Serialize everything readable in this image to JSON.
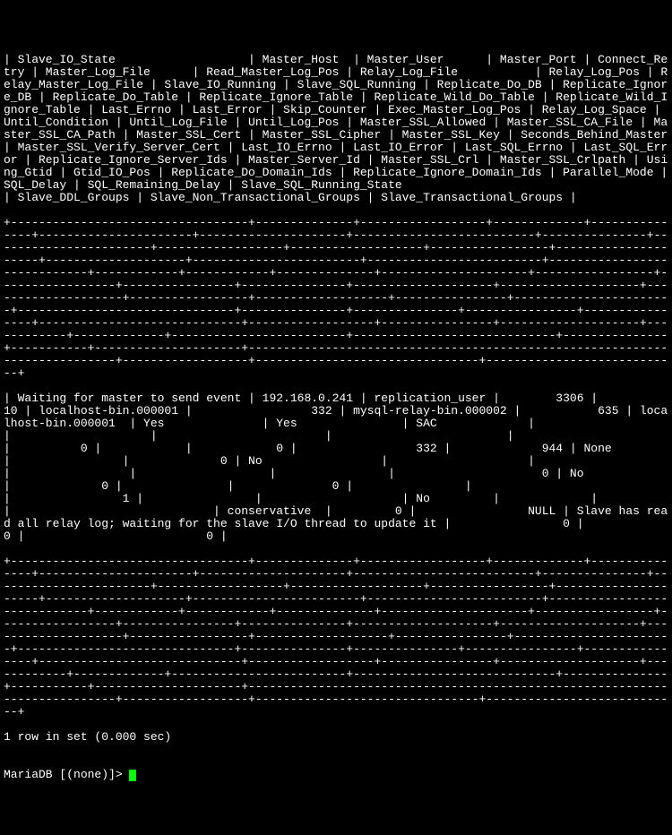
{
  "header_line": "| Slave_IO_State                   | Master_Host  | Master_User      | Master_Port | Connect_Retry | Master_Log_File      | Read_Master_Log_Pos | Relay_Log_File           | Relay_Log_Pos | Relay_Master_Log_File | Slave_IO_Running | Slave_SQL_Running | Replicate_Do_DB | Replicate_Ignore_DB | Replicate_Do_Table | Replicate_Ignore_Table | Replicate_Wild_Do_Table | Replicate_Wild_Ignore_Table | Last_Errno | Last_Error | Skip_Counter | Exec_Master_Log_Pos | Relay_Log_Space | Until_Condition | Until_Log_File | Until_Log_Pos | Master_SSL_Allowed | Master_SSL_CA_File | Master_SSL_CA_Path | Master_SSL_Cert | Master_SSL_Cipher | Master_SSL_Key | Seconds_Behind_Master | Master_SSL_Verify_Server_Cert | Last_IO_Errno | Last_IO_Error | Last_SQL_Errno | Last_SQL_Error | Replicate_Ignore_Server_Ids | Master_Server_Id | Master_SSL_Crl | Master_SSL_Crlpath | Using_Gtid | Gtid_IO_Pos | Replicate_Do_Domain_Ids | Replicate_Ignore_Domain_Ids | Parallel_Mode | SQL_Delay | SQL_Remaining_Delay | Slave_SQL_Running_State                                                    | Slave_DDL_Groups | Slave_Non_Transactional_Groups | Slave_Transactional_Groups |",
  "sep_line": "+----------------------------------+--------------+------------------+-------------+---------------+----------------------+---------------------+--------------------------+---------------+-----------------------+------------------+-------------------+-----------------+---------------------+--------------------+------------------------+-------------------------+-----------------------------+------------+------------+--------------+---------------------+-----------------+-----------------+----------------+---------------+--------------------+--------------------+--------------------+-----------------+-------------------+----------------+-----------------------+-------------------------------+---------------+---------------+----------------+----------------+-----------------------------+------------------+----------------+--------------------+------------+-------------+-------------------------+-----------------------------+---------------+-----------+---------------------+----------------------------------------------------------------------------+------------------+--------------------------------+----------------------------+",
  "data_line": "| Waiting for master to send event | 192.168.0.241 | replication_user |        3306 |            10 | localhost-bin.000001 |                 332 | mysql-relay-bin.000002 |           635 | localhost-bin.000001  | Yes              | Yes               | SAC             |                     |                    |                        |                         |                             |          0 |            |            0 |                 332 |             944 | None            |                |             0 | No                 |                    |                    |                 |                   |                |                     0 | No                            |             0 |               |              0 |                |                             |                1 |                |                    | No         |             |                         |                             | conservative  |         0 |                NULL | Slave has read all relay log; waiting for the slave I/O thread to update it |                0 |                              0 |                          0 |",
  "result_line": "1 row in set (0.000 sec)",
  "blank": "",
  "prompt_text": "MariaDB [(none)]> "
}
